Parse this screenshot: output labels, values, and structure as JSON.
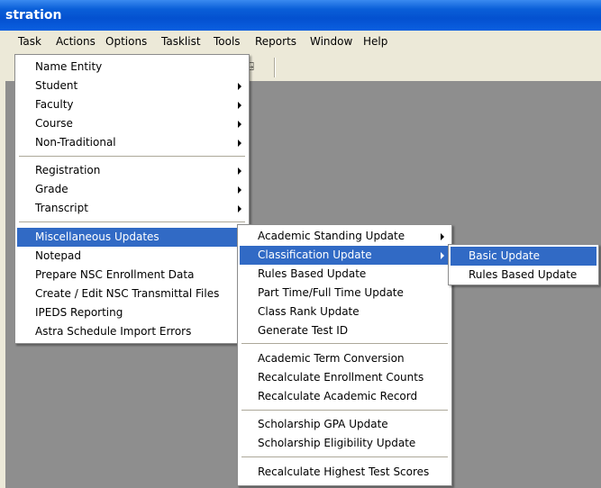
{
  "window": {
    "title": "stration"
  },
  "menubar": [
    "Task",
    "Actions",
    "Options",
    "Tasklist",
    "Tools",
    "Reports",
    "Window",
    "Help"
  ],
  "task_menu": {
    "items": [
      {
        "label": "Name Entity"
      },
      {
        "label": "Student"
      },
      {
        "label": "Faculty"
      },
      {
        "label": "Course"
      },
      {
        "label": "Non-Traditional"
      },
      {
        "label": "Registration"
      },
      {
        "label": "Grade"
      },
      {
        "label": "Transcript"
      },
      {
        "label": "Miscellaneous Updates"
      },
      {
        "label": "Notepad"
      },
      {
        "label": "Prepare NSC Enrollment Data"
      },
      {
        "label": "Create / Edit NSC Transmittal Files"
      },
      {
        "label": "IPEDS Reporting"
      },
      {
        "label": "Astra Schedule Import Errors"
      }
    ]
  },
  "misc_menu": {
    "items": [
      {
        "label": "Academic Standing Update"
      },
      {
        "label": "Classification Update"
      },
      {
        "label": "Rules Based Update"
      },
      {
        "label": "Part Time/Full Time Update"
      },
      {
        "label": "Class Rank Update"
      },
      {
        "label": "Generate Test ID"
      },
      {
        "label": "Academic Term Conversion"
      },
      {
        "label": "Recalculate Enrollment Counts"
      },
      {
        "label": "Recalculate Academic Record"
      },
      {
        "label": "Scholarship GPA Update"
      },
      {
        "label": "Scholarship Eligibility Update"
      },
      {
        "label": "Recalculate Highest Test Scores"
      }
    ]
  },
  "classification_menu": {
    "items": [
      {
        "label": "Basic Update"
      },
      {
        "label": "Rules Based Update"
      }
    ]
  },
  "colors": {
    "highlight": "#316ac5",
    "titlebar": "#0a5fd8",
    "workspace": "#8e8e8e",
    "menubar": "#ece9d8"
  },
  "icons": {
    "toolbar_exit": "door-exit-icon",
    "submenu": "submenu-arrow-icon"
  }
}
